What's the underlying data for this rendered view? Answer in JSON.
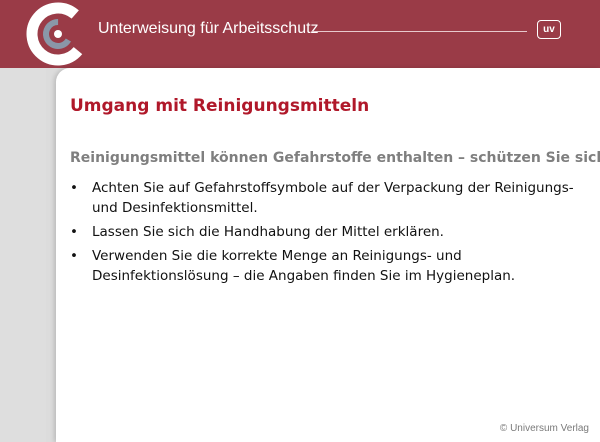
{
  "header": {
    "title": "Unterweisung für Arbeitsschutz",
    "badge": "uv",
    "logo_icon": "ring-logo-icon",
    "band_color": "#9a3b47"
  },
  "slide": {
    "title": "Umgang mit Reinigungsmitteln",
    "subtitle": "Reinigungsmittel können Gefahrstoffe enthalten – schützen Sie sich!",
    "bullets": [
      "Achten Sie auf Gefahrstoffsymbole auf der Verpackung der Reinigungs- und Desinfektionsmittel.",
      "Lassen Sie sich die Handhabung der Mittel erklären.",
      "Verwenden Sie die korrekte Menge an Reinigungs- und Desinfektionslösung – die Angaben finden Sie im Hygieneplan."
    ],
    "title_color": "#b0182a",
    "subtitle_color": "#7f7f7f"
  },
  "footer": {
    "copyright": "© Universum Verlag"
  }
}
